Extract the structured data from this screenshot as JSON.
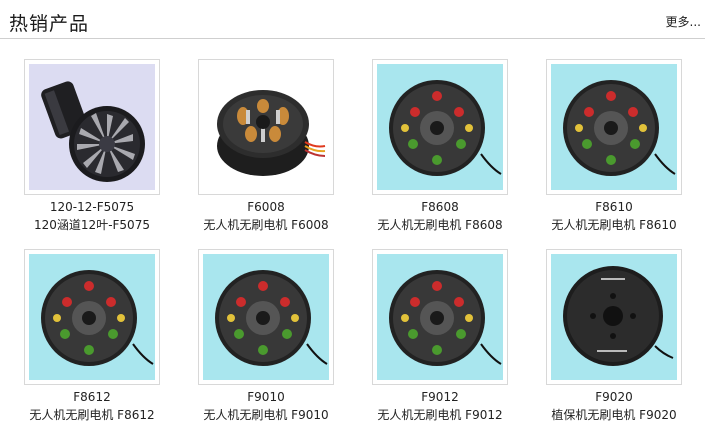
{
  "section": {
    "title": "热销产品",
    "more_label": "更多..."
  },
  "products": [
    {
      "model": "120-12-F5075",
      "name": "120涵道12叶-F5075",
      "image": "ducted-fan-icon"
    },
    {
      "model": "F6008",
      "name": "无人机无刷电机 F6008",
      "image": "motor-icon"
    },
    {
      "model": "F8608",
      "name": "无人机无刷电机 F8608",
      "image": "motor-icon"
    },
    {
      "model": "F8610",
      "name": "无人机无刷电机 F8610",
      "image": "motor-icon"
    },
    {
      "model": "F8612",
      "name": "无人机无刷电机 F8612",
      "image": "motor-icon"
    },
    {
      "model": "F9010",
      "name": "无人机无刷电机 F9010",
      "image": "motor-icon"
    },
    {
      "model": "F9012",
      "name": "无人机无刷电机 F9012",
      "image": "motor-icon"
    },
    {
      "model": "F9020",
      "name": "植保机无刷电机 F9020",
      "image": "motor-icon"
    }
  ],
  "colors": {
    "thumb_bg_cyan": "#a9e6ee",
    "thumb_bg_lavender": "#d9dbf0",
    "motor_body": "#2e2e2e",
    "divider": "#cfcfcf"
  }
}
